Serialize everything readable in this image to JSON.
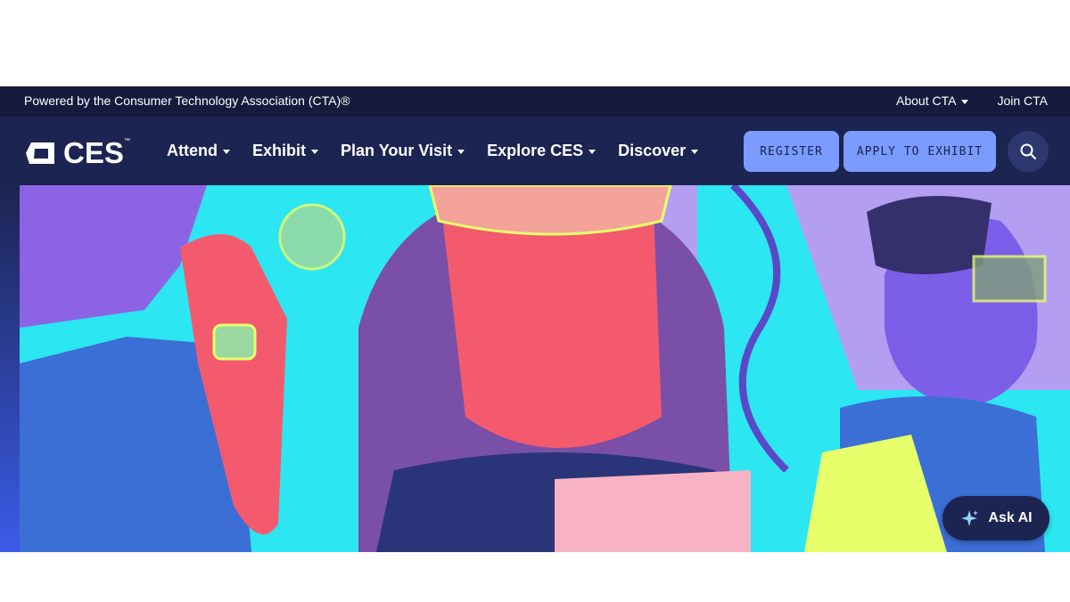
{
  "topbar": {
    "powered_by": "Powered by the Consumer Technology Association (CTA)®",
    "links": [
      "About CTA",
      "Join CTA"
    ]
  },
  "nav": {
    "logo_text": "CES",
    "logo_tm": "™",
    "menu": [
      "Attend",
      "Exhibit",
      "Plan Your Visit",
      "Explore CES",
      "Discover"
    ],
    "register_label": "REGISTER",
    "apply_label": "APPLY TO EXHIBIT",
    "search_icon": "search-icon"
  },
  "askai": {
    "label": "Ask AI",
    "icon": "sparkle-icon"
  },
  "colors": {
    "topbar_bg": "#141b3d",
    "nav_bg": "#1c2451",
    "button_bg": "#7b9bff",
    "hero_purple": "#8d63e6",
    "hero_cyan": "#2ce6f2",
    "hero_pink": "#f45a6e",
    "hero_yellow": "#e6ff6a"
  }
}
